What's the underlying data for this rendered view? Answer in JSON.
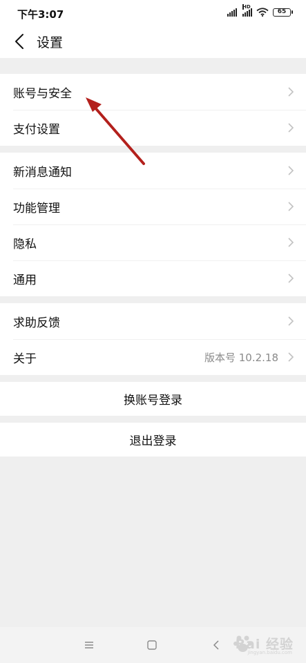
{
  "status_bar": {
    "time": "下午3:07",
    "hd_label": "HD",
    "battery": "65"
  },
  "header": {
    "title": "设置"
  },
  "groups": [
    {
      "items": [
        {
          "label": "账号与安全"
        },
        {
          "label": "支付设置"
        }
      ]
    },
    {
      "items": [
        {
          "label": "新消息通知"
        },
        {
          "label": "功能管理"
        },
        {
          "label": "隐私"
        },
        {
          "label": "通用"
        }
      ]
    },
    {
      "items": [
        {
          "label": "求助反馈"
        },
        {
          "label": "关于",
          "value": "版本号 10.2.18"
        }
      ]
    }
  ],
  "actions": {
    "switch_account": "换账号登录",
    "logout": "退出登录"
  },
  "annotation": {
    "arrow_color": "#b3201c"
  },
  "watermark": {
    "text": "Bai 经验",
    "sub": "jingyan.baidu.com"
  },
  "colors": {
    "background": "#efefef",
    "surface": "#ffffff",
    "chevron": "#c2c2c2",
    "secondary_text": "#8a8a8a"
  }
}
